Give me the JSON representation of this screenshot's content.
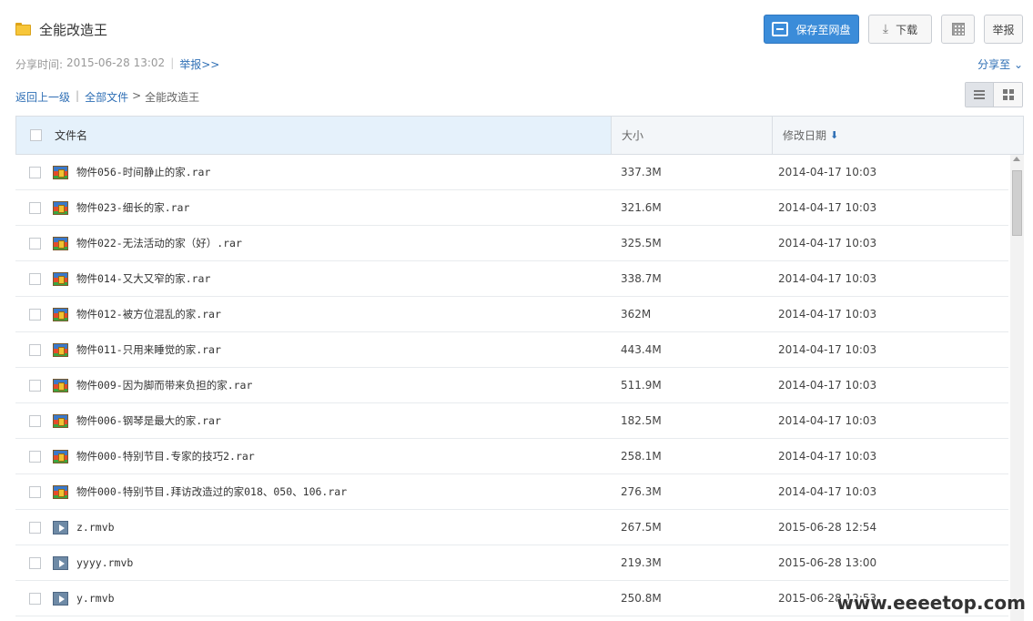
{
  "header": {
    "title": "全能改造王",
    "folder_icon": "folder-icon"
  },
  "toolbar": {
    "save_label": "保存至网盘",
    "download_label": "下载",
    "report_label": "举报",
    "primary_color": "#3b8cd9"
  },
  "meta": {
    "share_time_label": "分享时间:",
    "share_time": "2015-06-28 13:02",
    "report_link": "举报>>",
    "share_to": "分享至"
  },
  "breadcrumb": {
    "back": "返回上一级",
    "all_files": "全部文件",
    "sep": ">",
    "current": "全能改造王"
  },
  "table": {
    "headers": {
      "name": "文件名",
      "size": "大小",
      "date": "修改日期"
    },
    "rows": [
      {
        "name": "物件056-时间静止的家.rar",
        "size": "337.3M",
        "date": "2014-04-17 10:03",
        "icon": "rar"
      },
      {
        "name": "物件023-细长的家.rar",
        "size": "321.6M",
        "date": "2014-04-17 10:03",
        "icon": "rar"
      },
      {
        "name": "物件022-无法活动的家（好）.rar",
        "size": "325.5M",
        "date": "2014-04-17 10:03",
        "icon": "rar"
      },
      {
        "name": "物件014-又大又窄的家.rar",
        "size": "338.7M",
        "date": "2014-04-17 10:03",
        "icon": "rar"
      },
      {
        "name": "物件012-被方位混乱的家.rar",
        "size": "362M",
        "date": "2014-04-17 10:03",
        "icon": "rar"
      },
      {
        "name": "物件011-只用来睡觉的家.rar",
        "size": "443.4M",
        "date": "2014-04-17 10:03",
        "icon": "rar"
      },
      {
        "name": "物件009-因为脚而带来负担的家.rar",
        "size": "511.9M",
        "date": "2014-04-17 10:03",
        "icon": "rar"
      },
      {
        "name": "物件006-钢琴是最大的家.rar",
        "size": "182.5M",
        "date": "2014-04-17 10:03",
        "icon": "rar"
      },
      {
        "name": "物件000-特别节目.专家的技巧2.rar",
        "size": "258.1M",
        "date": "2014-04-17 10:03",
        "icon": "rar"
      },
      {
        "name": "物件000-特别节目.拜访改造过的家018、050、106.rar",
        "size": "276.3M",
        "date": "2014-04-17 10:03",
        "icon": "rar"
      },
      {
        "name": "z.rmvb",
        "size": "267.5M",
        "date": "2015-06-28 12:54",
        "icon": "video"
      },
      {
        "name": "yyyy.rmvb",
        "size": "219.3M",
        "date": "2015-06-28 13:00",
        "icon": "video"
      },
      {
        "name": "y.rmvb",
        "size": "250.8M",
        "date": "2015-06-28 12:53",
        "icon": "video"
      }
    ]
  },
  "watermark": "www.eeeetop.com"
}
